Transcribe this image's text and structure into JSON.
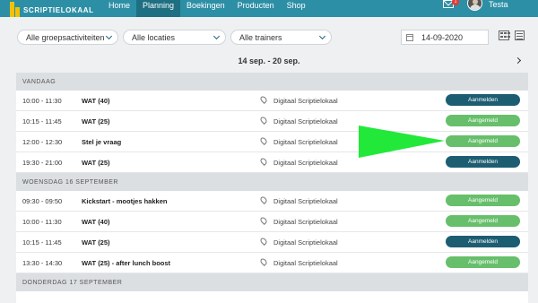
{
  "nav": {
    "logo_text": "SCRIPTIELOKAAL",
    "items": [
      {
        "label": "Home",
        "active": false
      },
      {
        "label": "Planning",
        "active": true
      },
      {
        "label": "Boekingen",
        "active": false
      },
      {
        "label": "Producten",
        "active": false
      },
      {
        "label": "Shop",
        "active": false
      }
    ],
    "mail_badge": "1",
    "user_name": "Testa"
  },
  "filters": {
    "activities": "Alle groepsactiviteiten",
    "locations": "Alle locaties",
    "trainers": "Alle trainers",
    "date": "14-09-2020"
  },
  "week_label": "14 sep. - 20 sep.",
  "days": [
    {
      "header": "VANDAAG",
      "rows": [
        {
          "time": "10:00 - 11:30",
          "title": "WAT (40)",
          "location": "Digitaal Scriptielokaal",
          "action": "Aanmelden",
          "status": "enroll"
        },
        {
          "time": "10:15 - 11:45",
          "title": "WAT (25)",
          "location": "Digitaal Scriptielokaal",
          "action": "Aangemeld",
          "status": "enrolled"
        },
        {
          "time": "12:00 - 12:30",
          "title": "Stel je vraag",
          "location": "Digitaal Scriptielokaal",
          "action": "Aangemeld",
          "status": "enrolled"
        },
        {
          "time": "19:30 - 21:00",
          "title": "WAT (25)",
          "location": "Digitaal Scriptielokaal",
          "action": "Aanmelden",
          "status": "enroll"
        }
      ]
    },
    {
      "header": "WOENSDAG 16 SEPTEMBER",
      "rows": [
        {
          "time": "09:30 - 09:50",
          "title": "Kickstart - mootjes hakken",
          "location": "Digitaal Scriptielokaal",
          "action": "Aangemeld",
          "status": "enrolled"
        },
        {
          "time": "10:00 - 11:30",
          "title": "WAT (40)",
          "location": "Digitaal Scriptielokaal",
          "action": "Aangemeld",
          "status": "enrolled"
        },
        {
          "time": "10:15 - 11:45",
          "title": "WAT (25)",
          "location": "Digitaal Scriptielokaal",
          "action": "Aanmelden",
          "status": "enroll"
        },
        {
          "time": "13:30 - 14:30",
          "title": "WAT (25) - after lunch boost",
          "location": "Digitaal Scriptielokaal",
          "action": "Aangemeld",
          "status": "enrolled"
        }
      ]
    },
    {
      "header": "DONDERDAG 17 SEPTEMBER",
      "rows": []
    }
  ],
  "colors": {
    "nav_bg": "#2d8fa5",
    "enroll_btn": "#1d5d72",
    "enrolled_btn": "#67bf6b",
    "annotation_arrow": "#22e83a"
  }
}
